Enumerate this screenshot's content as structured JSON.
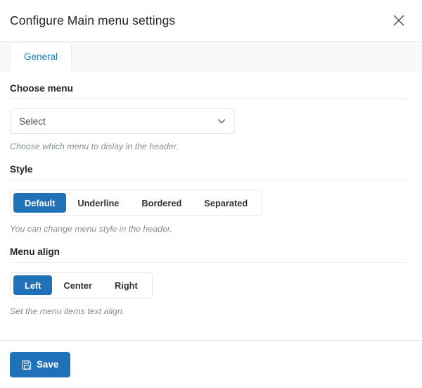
{
  "header": {
    "title": "Configure Main menu settings",
    "close_label": "×"
  },
  "tabs": [
    {
      "label": "General",
      "active": true
    }
  ],
  "fields": {
    "choose_menu": {
      "label": "Choose menu",
      "select_value": "Select",
      "help": "Choose which menu to dislay in the header."
    },
    "style": {
      "label": "Style",
      "options": [
        "Default",
        "Underline",
        "Bordered",
        "Separated"
      ],
      "selected": "Default",
      "help": "You can change menu style in the header."
    },
    "menu_align": {
      "label": "Menu align",
      "options": [
        "Left",
        "Center",
        "Right"
      ],
      "selected": "Left",
      "help": "Set the menu items text align."
    }
  },
  "footer": {
    "save_label": "Save"
  },
  "colors": {
    "accent": "#2071b8",
    "tab_text": "#1b7ec2",
    "border": "#e9ecef",
    "help_text": "#868e96",
    "tab_strip_bg": "#f8f9fa"
  },
  "icons": {
    "close": "close-icon",
    "chevron": "chevron-down-icon",
    "save": "floppy-disk-icon"
  }
}
